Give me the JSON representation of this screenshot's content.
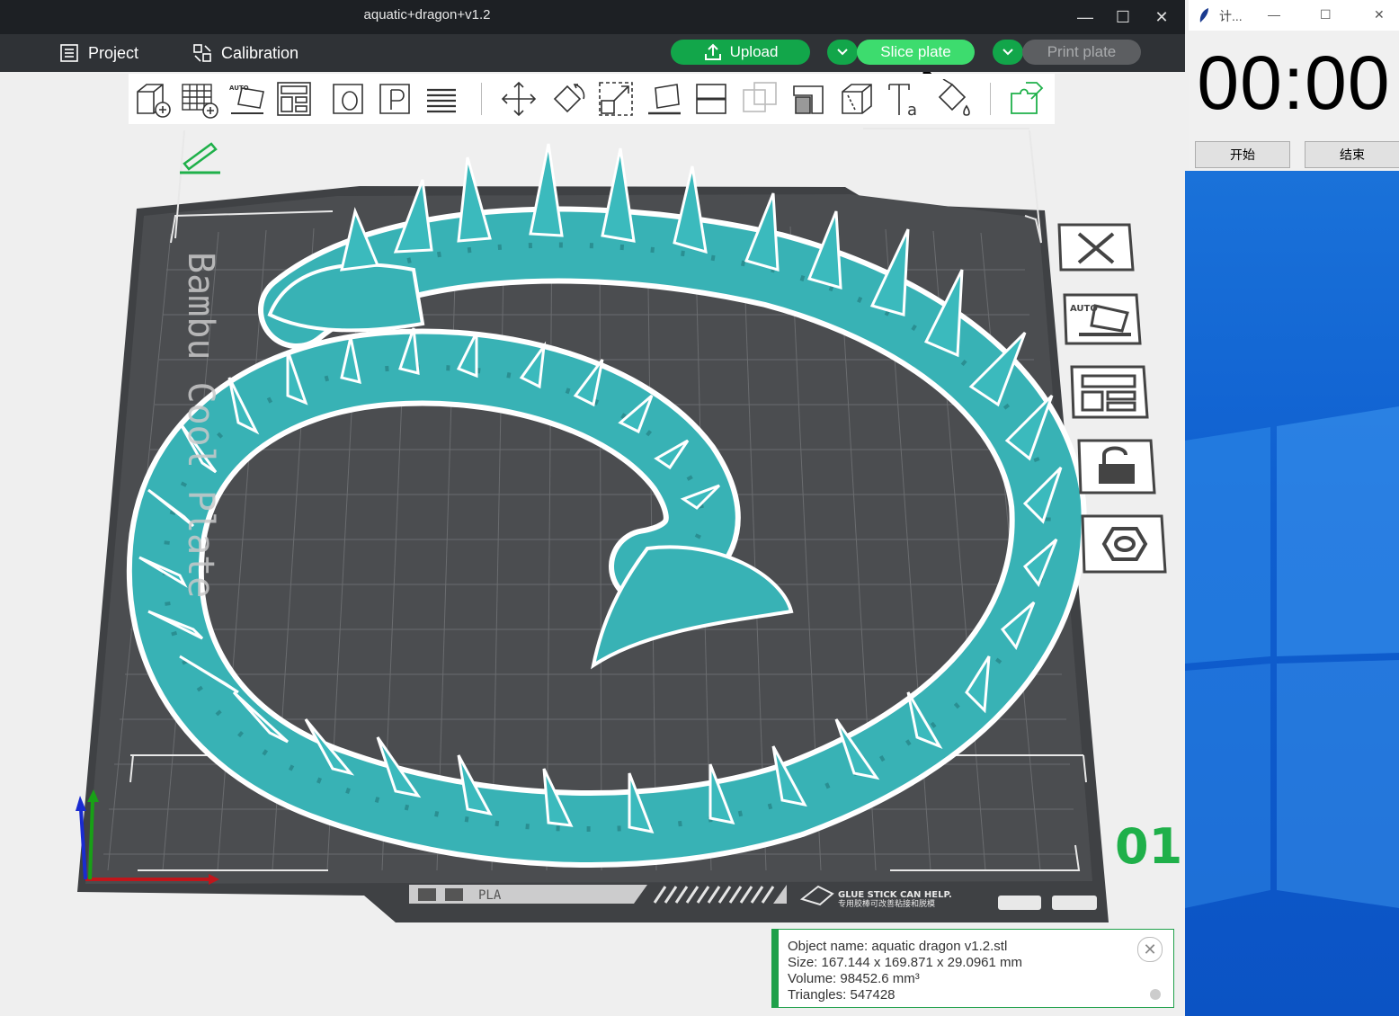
{
  "window": {
    "title": "aquatic+dragon+v1.2",
    "minimize": "—",
    "maximize": "☐",
    "close": "✕"
  },
  "menu": {
    "project": "Project",
    "calibration": "Calibration"
  },
  "actions": {
    "upload": "Upload",
    "slice": "Slice plate",
    "print": "Print plate"
  },
  "plate": {
    "label": "Bambu Cool Plate",
    "number": "01",
    "material": "PLA",
    "hint_en": "GLUE STICK CAN HELP.",
    "hint_cn": "专用胶棒可改善粘接和脱模"
  },
  "object_info": {
    "name": "Object name: aquatic dragon v1.2.stl",
    "size": "Size: 167.144 x 169.871 x 29.0961 mm",
    "volume": "Volume: 98452.6 mm³",
    "triangles": "Triangles: 547428"
  },
  "timer": {
    "title": "计...",
    "time": "00:00",
    "start": "开始",
    "stop": "结束"
  },
  "colors": {
    "accent": "#1fb04a",
    "model": "#3ab5b8",
    "bed": "#4a4c4f",
    "titlebar": "#1d2024",
    "menubar": "#2f3236"
  },
  "toolbar_icons": [
    "add-object-icon",
    "add-plate-icon",
    "auto-orient-icon",
    "arrange-icon",
    "split-objects-icon",
    "split-parts-icon",
    "layers-icon",
    "move-icon",
    "rotate-icon",
    "scale-icon",
    "lay-on-face-icon",
    "cut-icon",
    "boolean-icon",
    "support-paint-icon",
    "seam-paint-icon",
    "text-icon",
    "color-paint-icon",
    "assembly-icon"
  ],
  "side_icons": [
    "close-view-icon",
    "auto-orient-side-icon",
    "arrange-side-icon",
    "lock-icon",
    "settings-icon"
  ]
}
